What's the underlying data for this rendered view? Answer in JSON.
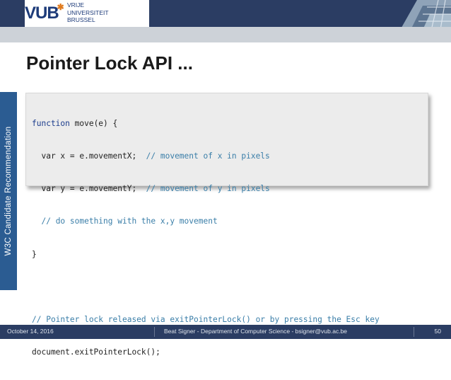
{
  "header": {
    "logo_mark": "VUB",
    "logo_lines": [
      "VRIJE",
      "UNIVERSITEIT",
      "BRUSSEL"
    ]
  },
  "slide": {
    "title": "Pointer Lock API ...",
    "side_label": "W3C Candidate Recommendation",
    "code_lines": [
      {
        "kw": "function",
        "code": " move(e) {",
        "comment": ""
      },
      {
        "kw": "",
        "code": "  var x = e.movementX;  ",
        "comment": "// movement of x in pixels"
      },
      {
        "kw": "",
        "code": "  var y = e.movementY;  ",
        "comment": "// movement of y in pixels"
      },
      {
        "kw": "",
        "code": "  ",
        "comment": "// do something with the x,y movement"
      },
      {
        "kw": "",
        "code": "}",
        "comment": ""
      },
      {
        "kw": "",
        "code": "",
        "comment": ""
      },
      {
        "kw": "",
        "code": "",
        "comment": "// Pointer lock released via exitPointerLock() or by pressing the Esc key"
      },
      {
        "kw": "",
        "code": "document.exitPointerLock();",
        "comment": ""
      }
    ]
  },
  "footer": {
    "date": "October 14, 2016",
    "center": "Beat Signer - Department of Computer Science - bsigner@vub.ac.be",
    "page": "50"
  },
  "colors": {
    "header_bg": "#2b3d63",
    "sidebar_bg": "#2b5c92",
    "keyword": "#1a3b8c",
    "comment": "#3a7ea8",
    "logo_blue": "#1d3b79",
    "logo_orange": "#e07b1f"
  }
}
